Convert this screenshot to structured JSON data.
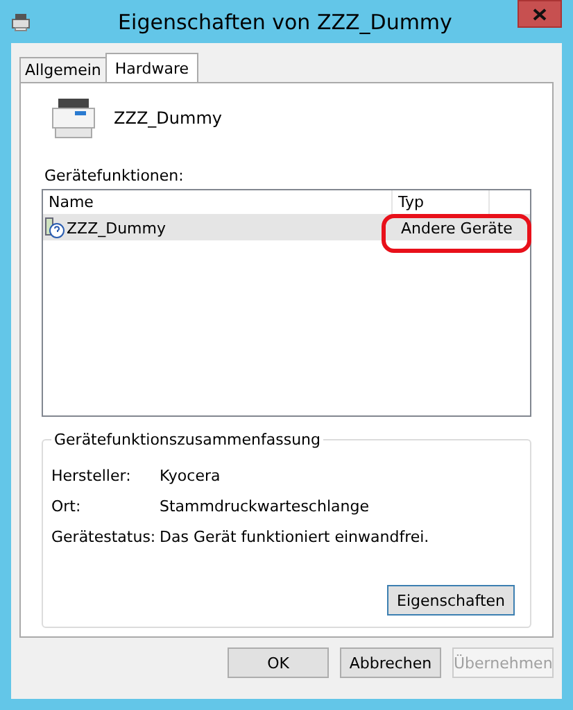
{
  "window": {
    "title": "Eigenschaften von ZZZ_Dummy"
  },
  "tabs": [
    {
      "label": "Allgemein",
      "selected": false
    },
    {
      "label": "Hardware",
      "selected": true
    }
  ],
  "device": {
    "name": "ZZZ_Dummy"
  },
  "functions": {
    "label": "Gerätefunktionen:",
    "columns": [
      "Name",
      "Typ"
    ],
    "rows": [
      {
        "name": "ZZZ_Dummy",
        "type": "Andere Geräte",
        "selected": true,
        "highlighted": true
      }
    ]
  },
  "summary": {
    "title": "Gerätefunktionszusammenfassung",
    "fields": [
      {
        "label": "Hersteller:",
        "value": "Kyocera"
      },
      {
        "label": "Ort:",
        "value": "Stammdruckwarteschlange"
      },
      {
        "label": "Gerätestatus:",
        "value": "Das Gerät funktioniert einwandfrei."
      }
    ],
    "button": "Eigenschaften"
  },
  "buttons": [
    {
      "label": "OK",
      "disabled": false
    },
    {
      "label": "Abbrechen",
      "disabled": false
    },
    {
      "label": "Übernehmen",
      "disabled": true
    }
  ]
}
